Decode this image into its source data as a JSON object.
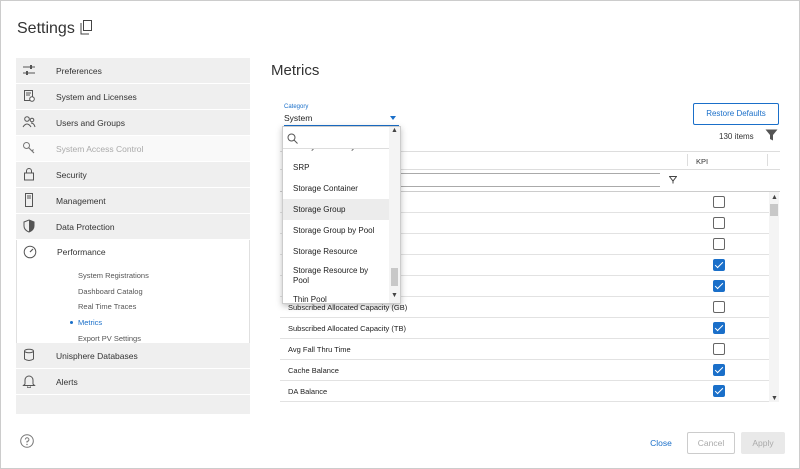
{
  "header": {
    "title": "Settings",
    "copy_icon": "copy-icon"
  },
  "sidebar": {
    "items_top": [
      {
        "label": "Preferences",
        "icon": "sliders-icon"
      },
      {
        "label": "System and Licenses",
        "icon": "license-icon"
      },
      {
        "label": "Users and Groups",
        "icon": "users-icon"
      },
      {
        "label": "System Access Control",
        "icon": "key-icon",
        "active": true
      },
      {
        "label": "Security",
        "icon": "lock-icon"
      },
      {
        "label": "Management",
        "icon": "server-icon"
      },
      {
        "label": "Data Protection",
        "icon": "shield-icon"
      }
    ],
    "performance": {
      "label": "Performance",
      "icon": "gauge-icon",
      "sub_items": [
        "System Registrations",
        "Dashboard Catalog",
        "Real Time Traces",
        "Metrics",
        "Export PV Settings"
      ],
      "current": "Metrics"
    },
    "items_bottom": [
      {
        "label": "Unisphere Databases",
        "icon": "database-icon"
      },
      {
        "label": "Alerts",
        "icon": "bell-icon"
      }
    ]
  },
  "main": {
    "title": "Metrics",
    "category": {
      "label": "Category",
      "value": "System"
    },
    "restore_label": "Restore Defaults",
    "items_count": "130 items",
    "table": {
      "kpi_header": "KPI",
      "rows": [
        {
          "label": "",
          "kpi": false
        },
        {
          "label": "",
          "kpi": false
        },
        {
          "label": "",
          "kpi": false
        },
        {
          "label": "",
          "kpi": true
        },
        {
          "label": "",
          "kpi": true
        },
        {
          "label": "Subscribed Allocated Capacity (GB)",
          "kpi": false
        },
        {
          "label": "Subscribed Allocated Capacity (TB)",
          "kpi": true
        },
        {
          "label": "Avg Fall Thru Time",
          "kpi": false
        },
        {
          "label": "Cache Balance",
          "kpi": true
        },
        {
          "label": "DA Balance",
          "kpi": true
        }
      ]
    },
    "dropdown": {
      "options": [
        "SG by FE Port by SG",
        "SRP",
        "Storage Container",
        "Storage Group",
        "Storage Group by Pool",
        "Storage Resource",
        "Storage Resource by Pool",
        "Thin Pool"
      ],
      "highlighted": "Storage Group"
    }
  },
  "footer": {
    "close_label": "Close",
    "cancel_label": "Cancel",
    "apply_label": "Apply"
  },
  "colors": {
    "accent": "#1a6fc9",
    "sidebar_bg": "#efefef"
  }
}
